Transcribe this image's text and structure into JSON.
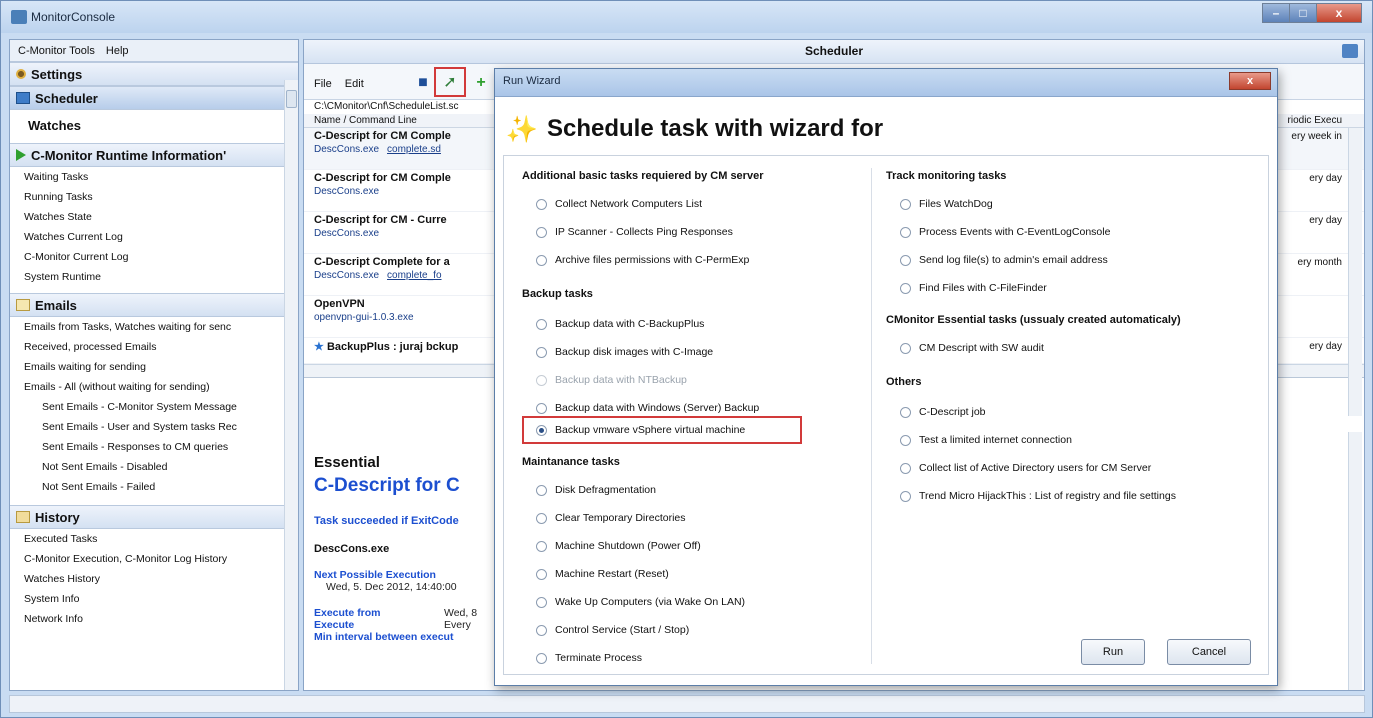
{
  "window": {
    "title": "MonitorConsole",
    "min": "–",
    "max": "□",
    "close": "x"
  },
  "left": {
    "menu": [
      "C-Monitor Tools",
      "Help"
    ],
    "settings": "Settings",
    "scheduler": "Scheduler",
    "watches": "Watches",
    "runtime": {
      "title": "C-Monitor Runtime Information'",
      "items": [
        "Waiting Tasks",
        "Running Tasks",
        "Watches State",
        "Watches Current Log",
        "C-Monitor Current Log",
        "System Runtime"
      ]
    },
    "emails": {
      "title": "Emails",
      "items": [
        "Emails from Tasks, Watches waiting for senc",
        "Received, processed Emails",
        "Emails waiting for sending",
        "Emails - All (without waiting for sending)"
      ],
      "subitems": [
        "Sent Emails - C-Monitor System Message",
        "Sent Emails - User and System tasks Rec",
        "Sent Emails - Responses to CM queries",
        "Not Sent Emails - Disabled",
        "Not Sent Emails - Failed"
      ]
    },
    "history": {
      "title": "History",
      "items": [
        "Executed Tasks",
        "C-Monitor Execution, C-Monitor Log History",
        "Watches History",
        "System Info",
        "Network Info"
      ]
    }
  },
  "scheduler": {
    "title": "Scheduler",
    "menu": [
      "File",
      "Edit"
    ],
    "path": "C:\\CMonitor\\Cnf\\ScheduleList.sc",
    "col_name": "Name / Command Line",
    "col_periodic": "riodic Execu",
    "tasks": [
      {
        "name": "C-Descript for CM Comple",
        "cmd": "DescCons.exe",
        "link": "complete.sd",
        "sched": "ery week in"
      },
      {
        "name": "C-Descript for CM Comple",
        "cmd": "DescCons.exe",
        "link": "",
        "sched": "ery day"
      },
      {
        "name": "C-Descript for CM - Curre",
        "cmd": "DescCons.exe",
        "link": "",
        "sched": "ery day"
      },
      {
        "name": "C-Descript Complete for a",
        "cmd": "DescCons.exe",
        "link": "complete_fo",
        "sched": "ery month"
      },
      {
        "name": "OpenVPN",
        "cmd": "openvpn-gui-1.0.3.exe",
        "link": "",
        "sched": ""
      },
      {
        "name": "BackupPlus : juraj bckup",
        "cmd": "",
        "link": "",
        "sched": "ery day"
      }
    ],
    "detail": {
      "essential": "Essential",
      "title": "C-Descript for C",
      "success": "Task succeeded if ExitCode",
      "exe": "DescCons.exe",
      "next_label": "Next Possible Execution",
      "next_value": "Wed, 5. Dec 2012, 14:40:00",
      "exec_from_label": "Execute from",
      "exec_from_value": "Wed, 8",
      "execute_label": "Execute",
      "execute_value": "Every",
      "min_interval_label": "Min interval between execut"
    }
  },
  "dialog": {
    "title": "Run Wizard",
    "heading": "Schedule task with wizard for",
    "left_sections": [
      {
        "title": "Additional basic tasks requiered by CM server",
        "options": [
          "Collect Network Computers List",
          "IP Scanner - Collects Ping Responses",
          "Archive files permissions with C-PermExp"
        ]
      },
      {
        "title": "Backup tasks",
        "options": [
          "Backup data with C-BackupPlus",
          "Backup disk images with C-Image",
          "Backup data with NTBackup",
          "Backup data with Windows (Server) Backup",
          "Backup vmware vSphere virtual machine"
        ]
      },
      {
        "title": "Maintanance tasks",
        "options": [
          "Disk Defragmentation",
          "Clear Temporary Directories",
          "Machine Shutdown (Power Off)",
          "Machine Restart (Reset)",
          "Wake Up Computers (via Wake On LAN)",
          "Control Service (Start / Stop)",
          "Terminate Process"
        ]
      }
    ],
    "right_sections": [
      {
        "title": "Track monitoring tasks",
        "options": [
          "Files WatchDog",
          "Process Events with C-EventLogConsole",
          "Send log file(s) to admin's email address",
          "Find Files with C-FileFinder"
        ]
      },
      {
        "title": "CMonitor Essential tasks (ussualy created automaticaly)",
        "options": [
          "CM Descript with SW audit"
        ]
      },
      {
        "title": "Others",
        "options": [
          "C-Descript job",
          "Test a limited internet connection",
          "Collect list of Active Directory users for CM Server",
          "Trend Micro HijackThis : List of registry and file settings"
        ]
      }
    ],
    "selected": "Backup vmware vSphere virtual machine",
    "disabled": "Backup data with NTBackup",
    "run": "Run",
    "cancel": "Cancel"
  }
}
